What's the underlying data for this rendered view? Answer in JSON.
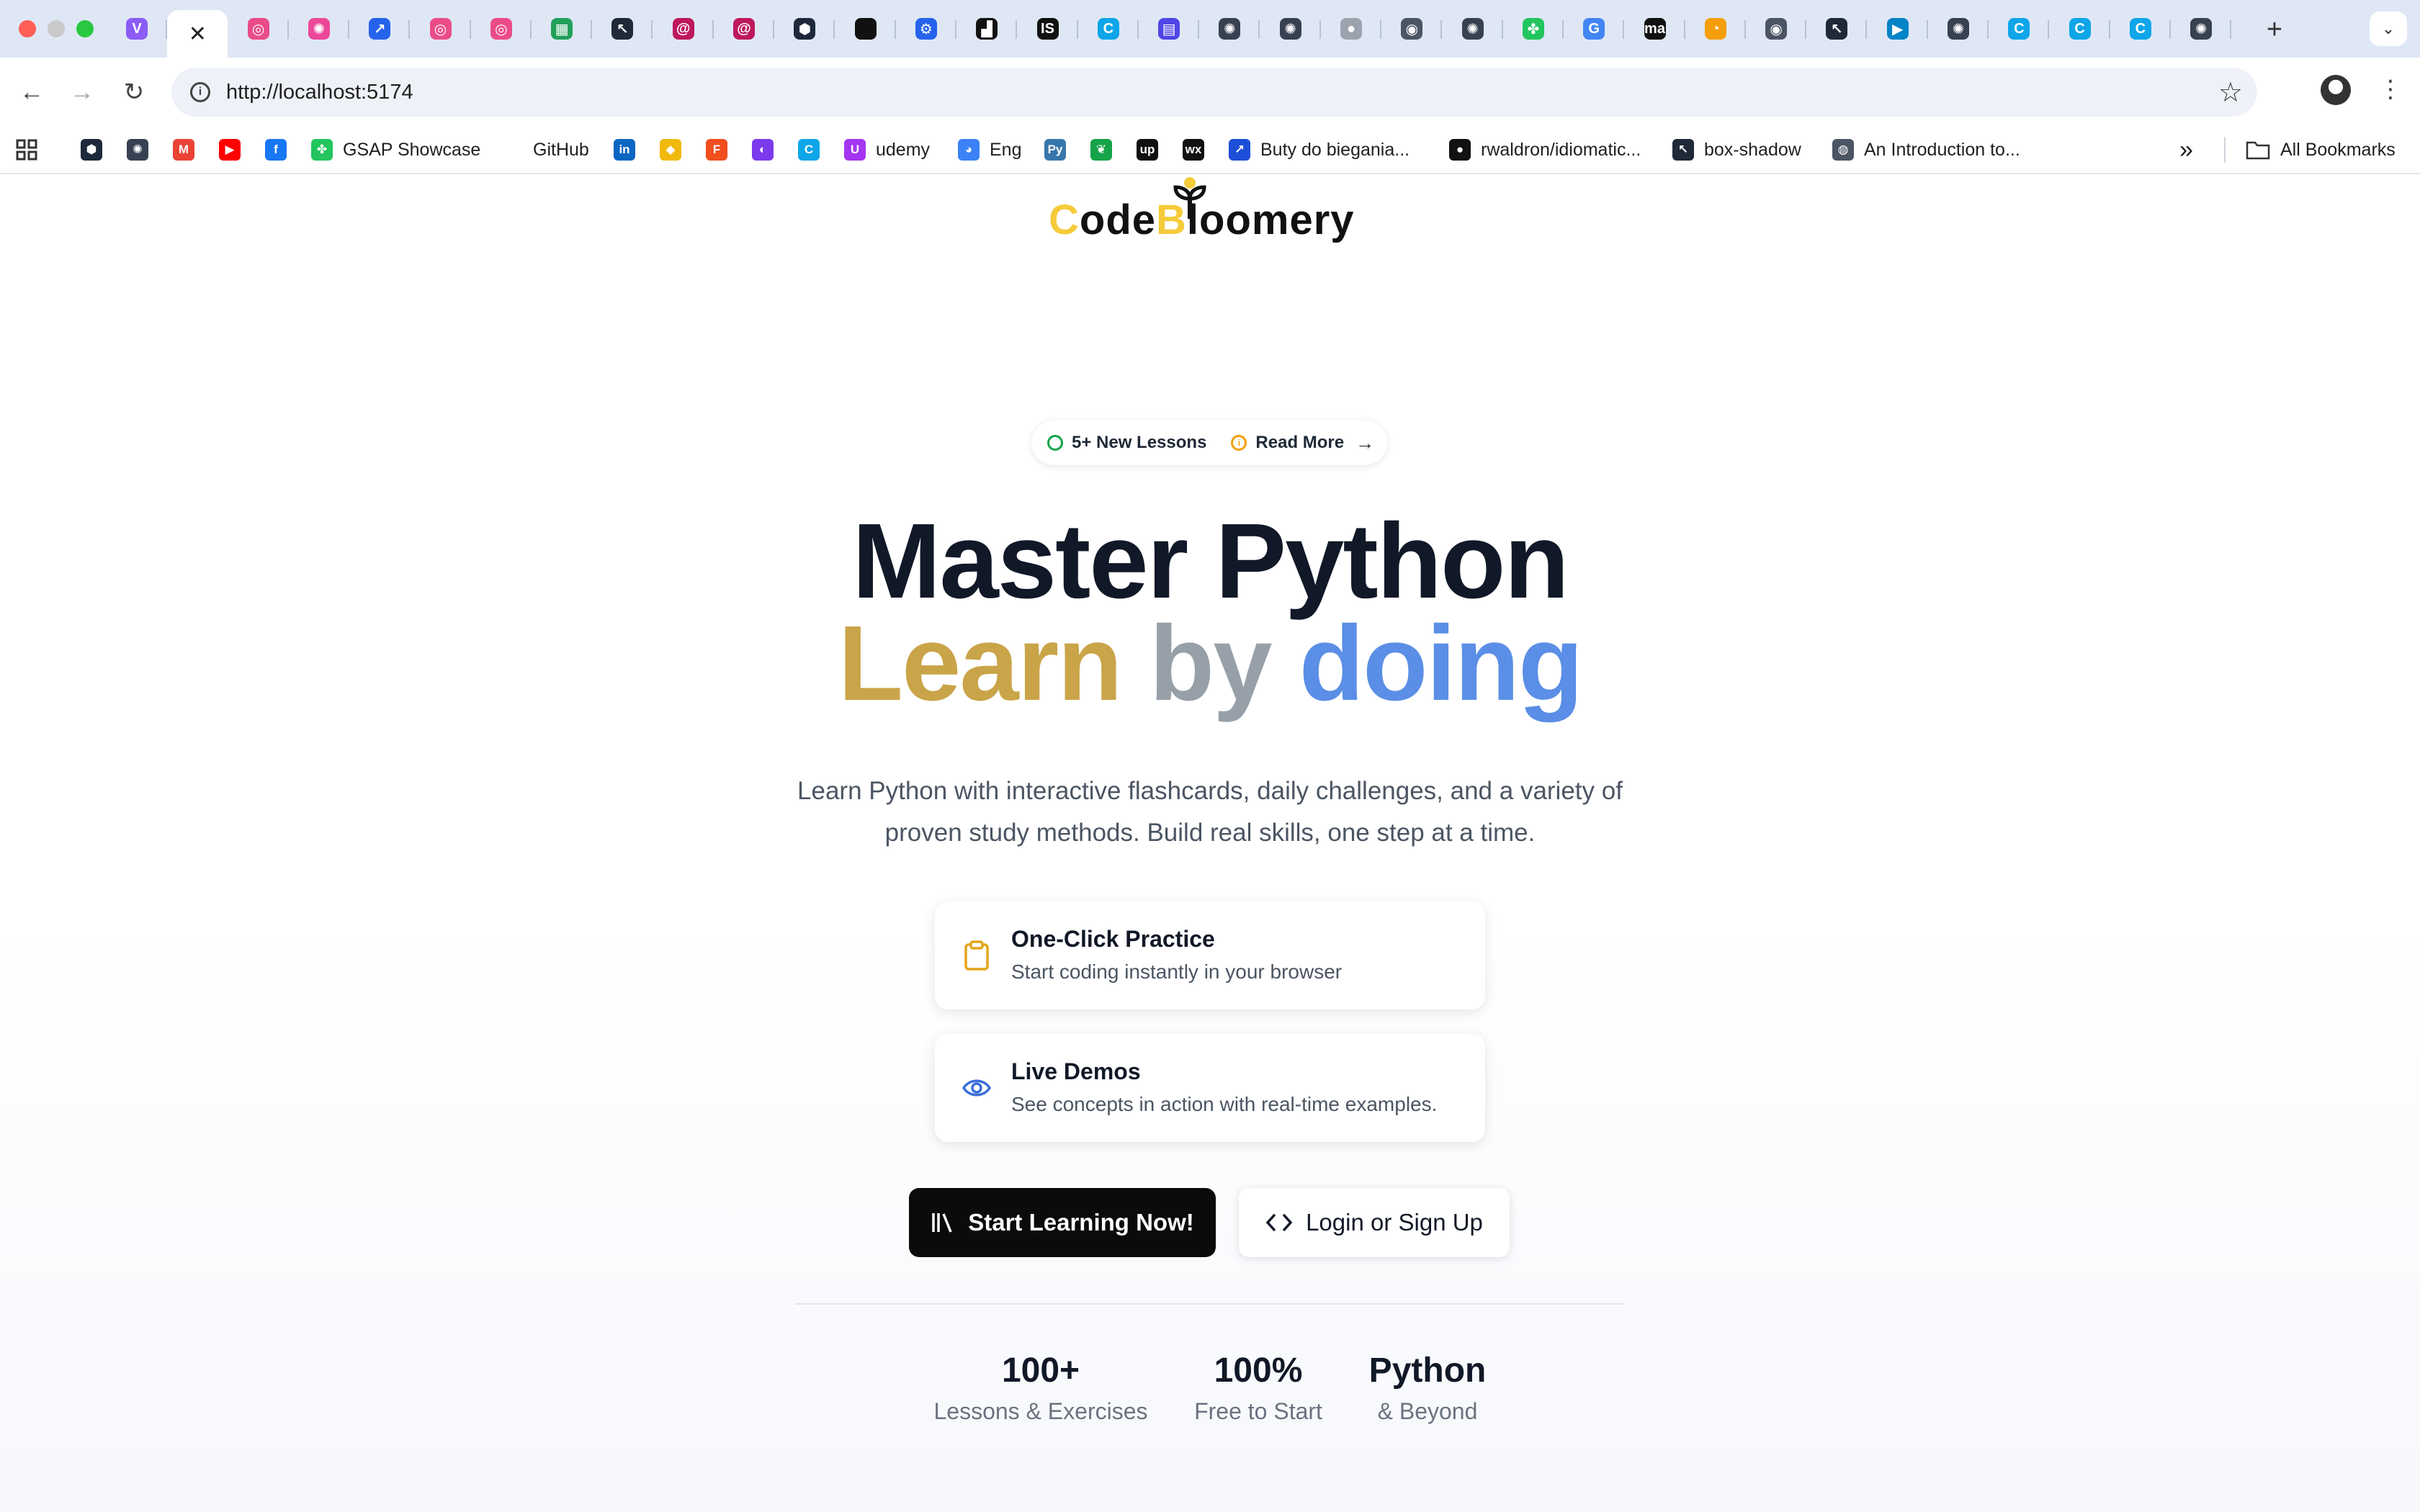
{
  "browser": {
    "url": "http://localhost:5174",
    "tab_close_glyph": "✕",
    "new_tab_glyph": "+",
    "tabs": [
      {
        "icon": "vite-icon",
        "color": "#8b5cf6",
        "glyph": "V"
      },
      {
        "icon": "close-icon",
        "active": true
      },
      {
        "icon": "dribbble-icon",
        "color": "#ea4c89",
        "glyph": "◎"
      },
      {
        "icon": "react-icon",
        "color": "#ec4899",
        "glyph": "✺"
      },
      {
        "icon": "app-icon",
        "color": "#2563eb",
        "glyph": "↗"
      },
      {
        "icon": "dribbble-icon",
        "color": "#ea4c89",
        "glyph": "◎"
      },
      {
        "icon": "dribbble-icon",
        "color": "#ea4c89",
        "glyph": "◎"
      },
      {
        "icon": "sheets-icon",
        "color": "#22a05a",
        "glyph": "▦"
      },
      {
        "icon": "cursor-icon",
        "color": "#1f2937",
        "glyph": "↖"
      },
      {
        "icon": "spiral-icon",
        "color": "#be185d",
        "glyph": "@"
      },
      {
        "icon": "spiral-icon",
        "color": "#be185d",
        "glyph": "@"
      },
      {
        "icon": "hex-icon",
        "color": "#1e293b",
        "glyph": "⬢"
      },
      {
        "icon": "apple-icon",
        "color": "#111111",
        "glyph": ""
      },
      {
        "icon": "gear-icon",
        "color": "#2563eb",
        "glyph": "⚙"
      },
      {
        "icon": "unsplash-icon",
        "color": "#111111",
        "glyph": "▟"
      },
      {
        "icon": "is-icon",
        "color": "#111111",
        "glyph": "IS"
      },
      {
        "icon": "edge-icon",
        "color": "#0ea5e9",
        "glyph": "C"
      },
      {
        "icon": "printer-icon",
        "color": "#4f46e5",
        "glyph": "▤"
      },
      {
        "icon": "openai-icon",
        "color": "#374151",
        "glyph": "✺"
      },
      {
        "icon": "openai-icon",
        "color": "#374151",
        "glyph": "✺"
      },
      {
        "icon": "github-icon",
        "color": "#9ca3af",
        "glyph": "●"
      },
      {
        "icon": "chrome-icon",
        "color": "#4b5563",
        "glyph": "◉"
      },
      {
        "icon": "openai-icon",
        "color": "#374151",
        "glyph": "✺"
      },
      {
        "icon": "puzzle-icon",
        "color": "#22c55e",
        "glyph": "✤"
      },
      {
        "icon": "google-icon",
        "color": "#4285f4",
        "glyph": "G"
      },
      {
        "icon": "ma-icon",
        "color": "#111111",
        "glyph": "ma"
      },
      {
        "icon": "loader-icon",
        "color": "#f59e0b",
        "glyph": "◔"
      },
      {
        "icon": "chrome-icon",
        "color": "#4b5563",
        "glyph": "◉"
      },
      {
        "icon": "cursor-icon",
        "color": "#1f2937",
        "glyph": "↖"
      },
      {
        "icon": "play-icon",
        "color": "#0284c7",
        "glyph": "▶"
      },
      {
        "icon": "openai-icon",
        "color": "#374151",
        "glyph": "✺"
      },
      {
        "icon": "edge-icon",
        "color": "#0ea5e9",
        "glyph": "C"
      },
      {
        "icon": "edge-icon",
        "color": "#0ea5e9",
        "glyph": "C"
      },
      {
        "icon": "edge-icon",
        "color": "#0ea5e9",
        "glyph": "C"
      },
      {
        "icon": "openai-icon",
        "color": "#374151",
        "glyph": "✺"
      }
    ]
  },
  "bookmarks": {
    "items": [
      {
        "icon": "hex-icon",
        "color": "#1e293b",
        "glyph": "⬢",
        "label": ""
      },
      {
        "icon": "openai-icon",
        "color": "#374151",
        "glyph": "✺",
        "label": ""
      },
      {
        "icon": "gmail-icon",
        "color": "#ea4335",
        "glyph": "M",
        "label": ""
      },
      {
        "icon": "youtube-icon",
        "color": "#ff0000",
        "glyph": "▶",
        "label": ""
      },
      {
        "icon": "facebook-icon",
        "color": "#1877f2",
        "glyph": "f",
        "label": ""
      },
      {
        "icon": "gsap-icon",
        "color": "#22c55e",
        "glyph": "✤",
        "label": "GSAP Showcase"
      },
      {
        "icon": "",
        "color": "",
        "glyph": "",
        "label": "GitHub"
      },
      {
        "icon": "linkedin-icon",
        "color": "#0a66c2",
        "glyph": "in",
        "label": ""
      },
      {
        "icon": "binance-icon",
        "color": "#f0b90b",
        "glyph": "◆",
        "label": ""
      },
      {
        "icon": "figma-icon",
        "color": "#f24e1e",
        "glyph": "F",
        "label": ""
      },
      {
        "icon": "arc-icon",
        "color": "#7c3aed",
        "glyph": "◐",
        "label": ""
      },
      {
        "icon": "edge-icon",
        "color": "#0ea5e9",
        "glyph": "C",
        "label": ""
      },
      {
        "icon": "udemy-icon",
        "color": "#a435f0",
        "glyph": "U",
        "label": "udemy"
      },
      {
        "icon": "eng-icon",
        "color": "#3b82f6",
        "glyph": "◕",
        "label": "Eng"
      },
      {
        "icon": "python-icon",
        "color": "#3776ab",
        "glyph": "Py",
        "label": ""
      },
      {
        "icon": "leaf-icon",
        "color": "#16a34a",
        "glyph": "❦",
        "label": ""
      },
      {
        "icon": "up-icon",
        "color": "#111111",
        "glyph": "up",
        "label": ""
      },
      {
        "icon": "wx-icon",
        "color": "#111111",
        "glyph": "wx",
        "label": ""
      },
      {
        "icon": "shoe-icon",
        "color": "#1d4ed8",
        "glyph": "↗",
        "label": "Buty do biegania..."
      },
      {
        "icon": "github-icon",
        "color": "#111111",
        "glyph": "●",
        "label": "rwaldron/idiomatic..."
      },
      {
        "icon": "cursor-icon",
        "color": "#1f2937",
        "glyph": "↖",
        "label": "box-shadow"
      },
      {
        "icon": "globe-icon",
        "color": "#4b5563",
        "glyph": "◍",
        "label": "An Introduction to..."
      }
    ],
    "overflow_glyph": "»",
    "all_bookmarks": "All Bookmarks"
  },
  "page": {
    "logo": {
      "first": "C",
      "mid": "ode",
      "b": "B",
      "rest": "loomery"
    },
    "announcement": {
      "lessons": "5+ New Lessons",
      "read_more": "Read More",
      "arrow": "→"
    },
    "hero": {
      "line1": "Master Python",
      "word1": "Learn",
      "word2": "by",
      "word3": "doing"
    },
    "description": "Learn Python with interactive flashcards, daily challenges, and a variety of proven study methods. Build real skills, one step at a time.",
    "features": [
      {
        "title": "One-Click Practice",
        "subtitle": "Start coding instantly in your browser",
        "icon": "clipboard-icon"
      },
      {
        "title": "Live Demos",
        "subtitle": "See concepts in action with real-time examples.",
        "icon": "eye-icon"
      }
    ],
    "cta": {
      "primary": "Start Learning Now!",
      "secondary": "Login or Sign Up"
    },
    "stats": [
      {
        "value": "100+",
        "label": "Lessons & Exercises"
      },
      {
        "value": "100%",
        "label": "Free to Start"
      },
      {
        "value": "Python",
        "label": "& Beyond"
      }
    ]
  },
  "colors": {
    "accent_gold": "#c9a448",
    "accent_grey": "#97a0a8",
    "accent_blue": "#5b8ee6",
    "logo_yellow": "#f5cb3a",
    "primary_button": "#0b0b0c"
  }
}
